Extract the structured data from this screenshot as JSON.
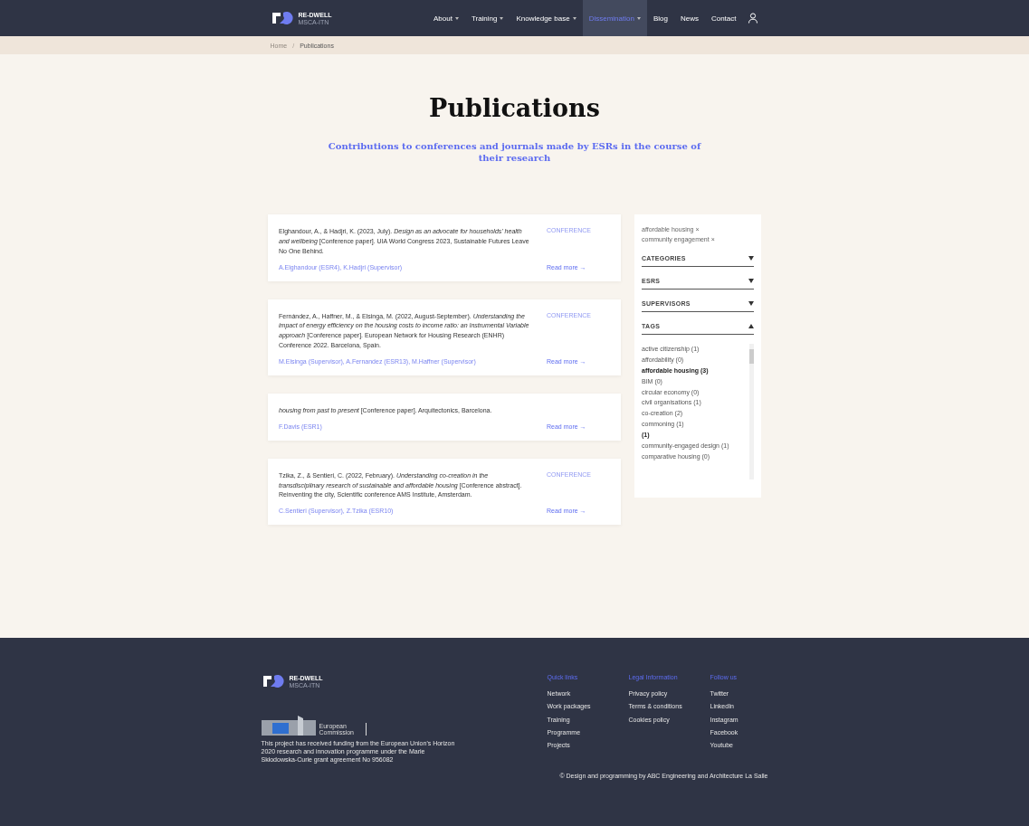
{
  "header": {
    "logo": {
      "name": "RE-DWELL",
      "subtitle": "MSCA-ITN"
    },
    "nav": [
      {
        "label": "About",
        "dropdown": true,
        "selected": false
      },
      {
        "label": "Training",
        "dropdown": true,
        "selected": false
      },
      {
        "label": "Knowledge base",
        "dropdown": true,
        "selected": false
      },
      {
        "label": "Dissemination",
        "dropdown": true,
        "selected": true
      },
      {
        "label": "Blog",
        "dropdown": false,
        "selected": false
      },
      {
        "label": "News",
        "dropdown": false,
        "selected": false
      },
      {
        "label": "Contact",
        "dropdown": false,
        "selected": false
      }
    ]
  },
  "breadcrumb": [
    "Home",
    "/",
    "Publications"
  ],
  "title": "Publications",
  "subtitle": "Contributions to conferences and journals made by ESRs in the course of their research",
  "publications": [
    {
      "citation": "Elghandour, A., & Hadjri, K. (2023, July). *Design as an advocate for households' health and wellbeing* [Conference paper]. UIA World Congress 2023, Sustainable Futures Leave No One Behind.",
      "authors": "A.Elghandour (ESR4), K.Hadjri (Supervisor)",
      "type": "CONFERENCE",
      "read_more": "Read more →"
    },
    {
      "citation": "Fernández, A., Haffner, M., & Elsinga, M. (2022, August-September). *Understanding the impact of energy efficiency on the housing costs to income ratio: an Instrumental Variable approach* [Conference paper]. European Network for Housing Research (ENHR) Conference 2022. Barcelona, Spain.",
      "authors": "M.Elsinga (Supervisor), A.Fernandez (ESR13), M.Haffner (Supervisor)",
      "type": "CONFERENCE",
      "read_more": "Read more →"
    },
    {
      "citation": "*housing from past to present* [Conference paper]. Arquitectonics, Barcelona.",
      "authors": "F.Davis (ESR1)",
      "read_more": "Read more →"
    },
    {
      "citation": "Tzika, Z., & Sentieri, C. (2022, February). *Understanding co-creation in the transdisciplinary research of sustainable and affordable housing* [Conference abstract]. Reinventing the city, Scientific conference AMS Institute, Amsterdam.",
      "authors": "C.Sentieri (Supervisor), Z.Tzika (ESR10)",
      "type": "CONFERENCE",
      "read_more": "Read more →"
    }
  ],
  "filters": {
    "active": [
      "affordable housing ×",
      "community engagement ×"
    ],
    "sections": [
      {
        "label": "CATEGORIES",
        "expanded": false
      },
      {
        "label": "ESRS",
        "expanded": false
      },
      {
        "label": "SUPERVISORS",
        "expanded": false
      },
      {
        "label": "TAGS",
        "expanded": true
      }
    ],
    "tags": [
      {
        "label": "active citizenship (1)",
        "selected": false
      },
      {
        "label": "affordability (0)",
        "selected": false
      },
      {
        "label": "affordable housing (3)",
        "selected": true
      },
      {
        "label": "BIM (0)",
        "selected": false
      },
      {
        "label": "circular economy (0)",
        "selected": false
      },
      {
        "label": "civil organisations (1)",
        "selected": false
      },
      {
        "label": "co-creation (2)",
        "selected": false
      },
      {
        "label": "commoning (1)",
        "selected": false
      },
      {
        "label": "(1)",
        "selected": true
      },
      {
        "label": "community-engaged design (1)",
        "selected": false
      },
      {
        "label": "comparative housing (0)",
        "selected": false
      }
    ]
  },
  "footer": {
    "logo": {
      "name": "RE-DWELL",
      "subtitle": "MSCA-ITN"
    },
    "eu_label": "European Commission",
    "funding": "This project has received funding from the European Union's Horizon 2020 research and innovation programme under the Marie Skłodowska-Curie grant agreement No 956082",
    "columns": [
      {
        "title": "Quick links",
        "links": [
          "Network",
          "Work packages",
          "Training",
          "Programme",
          "Projects"
        ]
      },
      {
        "title": "Legal Information",
        "links": [
          "Privacy policy",
          "Terms & conditions",
          "Cookies policy"
        ]
      },
      {
        "title": "Follow us",
        "links": [
          "Twitter",
          "LinkedIn",
          "Instagram",
          "Facebook",
          "Youtube"
        ]
      }
    ],
    "credit": "© Design and programming by ABC Engineering and Architecture La Salle"
  }
}
